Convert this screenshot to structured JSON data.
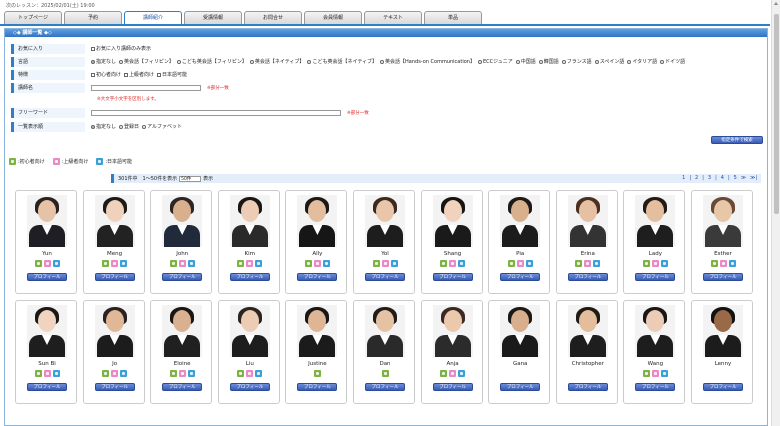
{
  "topline": "次のレッスン：2025/02/01(土) 19:00",
  "tabs": [
    {
      "label": "トップページ",
      "active": false
    },
    {
      "label": "予約",
      "active": false
    },
    {
      "label": "講師紹介",
      "active": true
    },
    {
      "label": "受講情報",
      "active": false
    },
    {
      "label": "お問合せ",
      "active": false
    },
    {
      "label": "会員情報",
      "active": false
    },
    {
      "label": "テキスト",
      "active": false
    },
    {
      "label": "単品",
      "active": false
    }
  ],
  "panel_title": "◇◆ 講師一覧 ◆◇",
  "form": {
    "favorite": {
      "label": "お気に入り",
      "option": "お気に入り講師のみ表示"
    },
    "language": {
      "label": "言語",
      "options": [
        "指定なし",
        "英会話【フィリピン】",
        "こども英会話【フィリピン】",
        "英会話【ネイティブ】",
        "こども英会話【ネイティブ】",
        "英会話【Hands-on Communication】",
        "ECCジュニア",
        "中国語",
        "韓国語",
        "フランス語",
        "スペイン語",
        "イタリア語",
        "ドイツ語"
      ],
      "selected": "指定なし"
    },
    "feature": {
      "label": "特徴",
      "options": [
        "初心者向け",
        "上級者向け",
        "日本語可能"
      ]
    },
    "teacher_name": {
      "label": "講師名",
      "value": "",
      "hint": "※部分一致",
      "note": "※大文字小文字を区別します。"
    },
    "freeword": {
      "label": "フリーワード",
      "value": "",
      "hint": "※部分一致"
    },
    "sort": {
      "label": "一覧表示順",
      "options": [
        "指定なし",
        "登録日",
        "アルファベット"
      ],
      "selected": "指定なし"
    },
    "search_button": "指定条件で検索"
  },
  "legend": [
    {
      "icon": "beginner-icon",
      "color": "#7cb342",
      "label": ":初心者向け"
    },
    {
      "icon": "advanced-icon",
      "color": "#e88ac4",
      "label": ":上級者向け"
    },
    {
      "icon": "japanese-icon",
      "color": "#3ba0d8",
      "label": ":日本語可能"
    }
  ],
  "results": {
    "count_text": "301件中　1〜50件を表示",
    "per_page": "50件",
    "suffix": "表示"
  },
  "pager": [
    "1",
    "|",
    "2",
    "|",
    "3",
    "|",
    "4",
    "|",
    "5",
    "≫",
    "≫|"
  ],
  "profile_label": "プロフィール",
  "teachers": [
    {
      "name": "Yun",
      "icons": [
        "g",
        "p",
        "b"
      ],
      "hair": "#2a2220",
      "skin": "#e6c3a6",
      "body": "#1e1e24"
    },
    {
      "name": "Meng",
      "icons": [
        "g",
        "p",
        "b"
      ],
      "hair": "#1e1a18",
      "skin": "#f0d2bc",
      "body": "#222"
    },
    {
      "name": "John",
      "icons": [
        "g",
        "p",
        "b"
      ],
      "hair": "#2e2622",
      "skin": "#d9b08e",
      "body": "#202a3a"
    },
    {
      "name": "Kim",
      "icons": [
        "g",
        "p",
        "b"
      ],
      "hair": "#1a1614",
      "skin": "#ecccb4",
      "body": "#2a2a2a"
    },
    {
      "name": "Ally",
      "icons": [
        "g",
        "p",
        "b"
      ],
      "hair": "#1c1816",
      "skin": "#e2bd9e",
      "body": "#161616"
    },
    {
      "name": "Yol",
      "icons": [
        "g",
        "p",
        "b"
      ],
      "hair": "#3a2a20",
      "skin": "#e9c6aa",
      "body": "#1d1d1d"
    },
    {
      "name": "Shang",
      "icons": [
        "g",
        "p",
        "b"
      ],
      "hair": "#18140f",
      "skin": "#f1d3bd",
      "body": "#1a1a1a"
    },
    {
      "name": "Pia",
      "icons": [
        "g",
        "p",
        "b"
      ],
      "hair": "#1f1a17",
      "skin": "#d8b08c",
      "body": "#1c1c1c"
    },
    {
      "name": "Erina",
      "icons": [
        "g",
        "p",
        "b"
      ],
      "hair": "#4a3020",
      "skin": "#e6c0a2",
      "body": "#333"
    },
    {
      "name": "Lady",
      "icons": [
        "g",
        "p",
        "b"
      ],
      "hair": "#221a16",
      "skin": "#e3bf9f",
      "body": "#1e1e1e"
    },
    {
      "name": "Esther",
      "icons": [
        "g",
        "p",
        "b"
      ],
      "hair": "#6a4a36",
      "skin": "#e8c6a8",
      "body": "#3a3a3a"
    },
    {
      "name": "Sun Bi",
      "icons": [
        "g",
        "p",
        "b"
      ],
      "hair": "#1c1816",
      "skin": "#f0d4c0",
      "body": "#1e1e1e"
    },
    {
      "name": "Jo",
      "icons": [
        "g",
        "p",
        "b"
      ],
      "hair": "#2a2220",
      "skin": "#e0b898",
      "body": "#1c1c1c"
    },
    {
      "name": "Eloine",
      "icons": [
        "g",
        "p",
        "b"
      ],
      "hair": "#1a1614",
      "skin": "#d9b090",
      "body": "#202020"
    },
    {
      "name": "Liu",
      "icons": [
        "g",
        "p",
        "b"
      ],
      "hair": "#2c2420",
      "skin": "#ecccb2",
      "body": "#1d1d1d"
    },
    {
      "name": "Justine",
      "icons": [
        "g"
      ],
      "hair": "#1a1614",
      "skin": "#deb696",
      "body": "#1b1b1b"
    },
    {
      "name": "Dan",
      "icons": [
        "g"
      ],
      "hair": "#221c18",
      "skin": "#e6c2a4",
      "body": "#2a2a2a"
    },
    {
      "name": "Anja",
      "icons": [
        "g",
        "p",
        "b"
      ],
      "hair": "#3a2a22",
      "skin": "#ecc8ac",
      "body": "#2b2b2b"
    },
    {
      "name": "Gana",
      "icons": [],
      "hair": "#1c1816",
      "skin": "#d8ae8c",
      "body": "#1a1a1a"
    },
    {
      "name": "Christopher",
      "icons": [],
      "hair": "#201a16",
      "skin": "#e4be9c",
      "body": "#1e1e1e"
    },
    {
      "name": "Wang",
      "icons": [
        "g",
        "p",
        "b"
      ],
      "hair": "#1a1614",
      "skin": "#ecccb6",
      "body": "#1d1d1d"
    },
    {
      "name": "Lenny",
      "icons": [],
      "hair": "#141210",
      "skin": "#9a6a48",
      "body": "#1c1c1c"
    }
  ]
}
